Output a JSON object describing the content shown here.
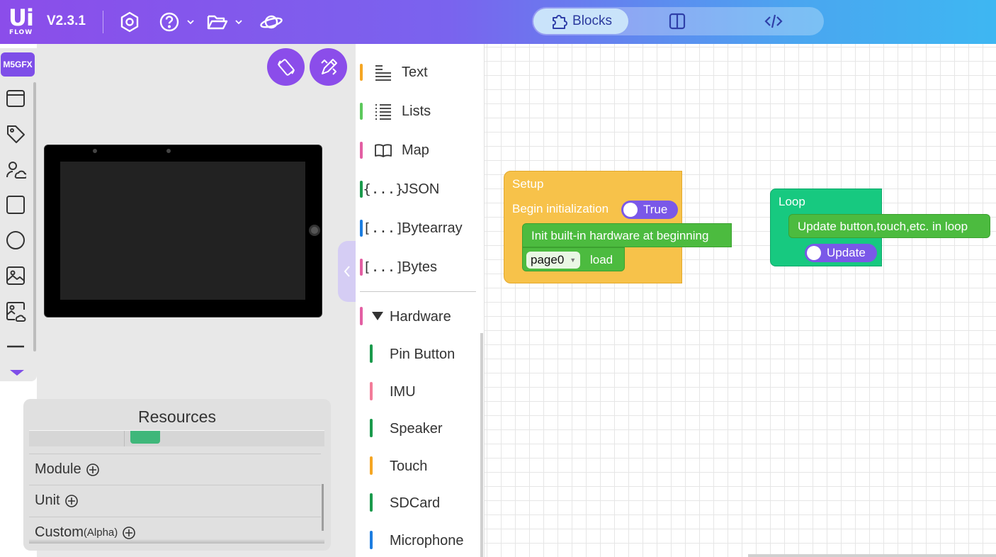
{
  "app": {
    "logo_top": "Ui",
    "logo_bottom": "FLOW",
    "version": "V2.3.1"
  },
  "view_switch": {
    "blocks_label": "Blocks"
  },
  "left_toolbar": {
    "badge": "M5GFX",
    "tools": [
      "window-icon",
      "tag-icon",
      "cloud-user-icon",
      "square-icon",
      "circle-icon",
      "image-icon",
      "cloud-image-icon",
      "line-icon"
    ]
  },
  "resources": {
    "title": "Resources",
    "rows": {
      "module": "Module",
      "unit": "Unit",
      "custom": "Custom",
      "custom_suffix": "(Alpha)"
    }
  },
  "categories": {
    "items": [
      {
        "label": "Text",
        "icon_text": "",
        "color": "#f5a623"
      },
      {
        "label": "Lists",
        "icon_text": "",
        "color": "#5cc85c"
      },
      {
        "label": "Map",
        "icon_text": "",
        "color": "#e35fa3"
      },
      {
        "label": "JSON",
        "icon_text": "{...}",
        "color": "#1a9a4c"
      },
      {
        "label": "Bytearray",
        "icon_text": "[...]",
        "color": "#1c7de0"
      },
      {
        "label": "Bytes",
        "icon_text": "[...]",
        "color": "#e35fa3"
      }
    ],
    "hardware": {
      "label": "Hardware",
      "items": [
        {
          "label": "Pin Button",
          "color": "#1a9a4c"
        },
        {
          "label": "IMU",
          "color": "#f37c99"
        },
        {
          "label": "Speaker",
          "color": "#1a9a4c"
        },
        {
          "label": "Touch",
          "color": "#f5a623"
        },
        {
          "label": "SDCard",
          "color": "#1a9a4c"
        },
        {
          "label": "Microphone",
          "color": "#1c7de0"
        }
      ]
    }
  },
  "workspace": {
    "setup": {
      "title": "Setup",
      "begin_label": "Begin initialization",
      "begin_value": "True",
      "init_label": "Init built-in hardware at beginning",
      "page_value": "page0",
      "load_label": "load"
    },
    "loop": {
      "title": "Loop",
      "update_label": "Update button,touch,etc. in loop",
      "update_toggle": "Update"
    }
  },
  "colors": {
    "accent": "#8b4dea",
    "setup_block": "#f7c24a",
    "loop_block": "#17c980",
    "hardware_block": "#4cbb3f",
    "toggle": "#7a58e8"
  }
}
